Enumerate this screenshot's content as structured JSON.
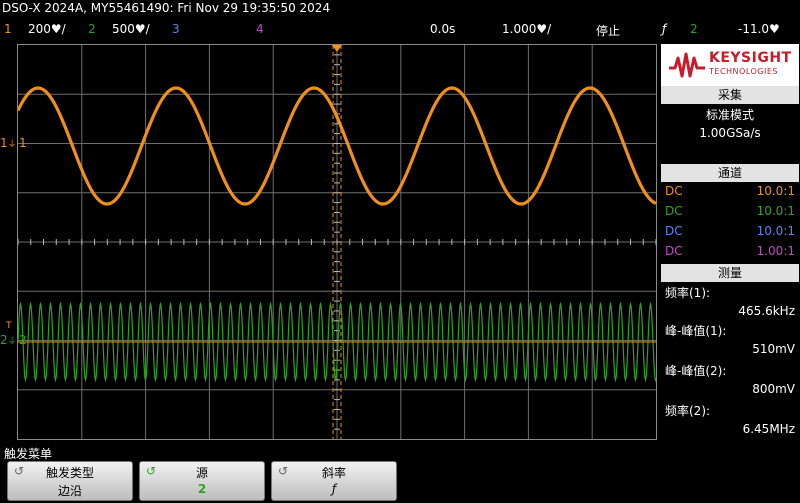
{
  "title": "DSO-X 2024A, MY55461490: Fri Nov 29 19:35:50 2024",
  "status_bar": {
    "ch1": {
      "num": "1",
      "scale": "200♥/"
    },
    "ch2": {
      "num": "2",
      "scale": "500♥/"
    },
    "ch3": {
      "num": "3"
    },
    "ch4": {
      "num": "4"
    },
    "time_delay": "0.0s",
    "time_scale": "1.000♥/",
    "run_state": "停止",
    "trigger_slope_icon": "rising-edge-icon",
    "trigger_slope_glyph": "ƒ",
    "trigger_source": "2",
    "trigger_level": "-11.0♥"
  },
  "colors": {
    "ch1": "#f0901a",
    "ch2": "#2ca51e",
    "ch3": "#5a82ff",
    "ch4": "#c04ac8",
    "trigger_marker": "#f0901a"
  },
  "screen": {
    "ch1_marker": "1",
    "ch2_marker": "2",
    "ch1_ground_label": "1",
    "ch2_ground_label": "2",
    "trigger_level_label": "T"
  },
  "logo": {
    "brand": "KEYSIGHT",
    "tagline": "TECHNOLOGIES"
  },
  "acquisition": {
    "header": "采集",
    "mode": "标准模式",
    "rate": "1.00GSa/s"
  },
  "channels": {
    "header": "通道",
    "rows": [
      {
        "coupling": "DC",
        "probe": "10.0:1"
      },
      {
        "coupling": "DC",
        "probe": "10.0:1"
      },
      {
        "coupling": "DC",
        "probe": "10.0:1"
      },
      {
        "coupling": "DC",
        "probe": "1.00:1"
      }
    ]
  },
  "measurements": {
    "header": "测量",
    "items": [
      {
        "label": "频率(1):",
        "value": "465.6kHz"
      },
      {
        "label": "峰-峰值(1):",
        "value": "510mV"
      },
      {
        "label": "峰-峰值(2):",
        "value": "800mV"
      },
      {
        "label": "频率(2):",
        "value": "6.45MHz"
      }
    ]
  },
  "softkeys": {
    "menu_title": "触发菜单",
    "buttons": [
      {
        "label": "触发类型",
        "value": "边沿"
      },
      {
        "label": "源",
        "value": "2"
      },
      {
        "label": "斜率",
        "value": "ƒ"
      }
    ]
  },
  "waveforms": {
    "ch1": {
      "type": "sine",
      "frequency": "465.6kHz",
      "peak_to_peak": "510mV"
    },
    "ch2": {
      "type": "sine",
      "frequency": "6.45MHz",
      "peak_to_peak": "800mV"
    }
  }
}
